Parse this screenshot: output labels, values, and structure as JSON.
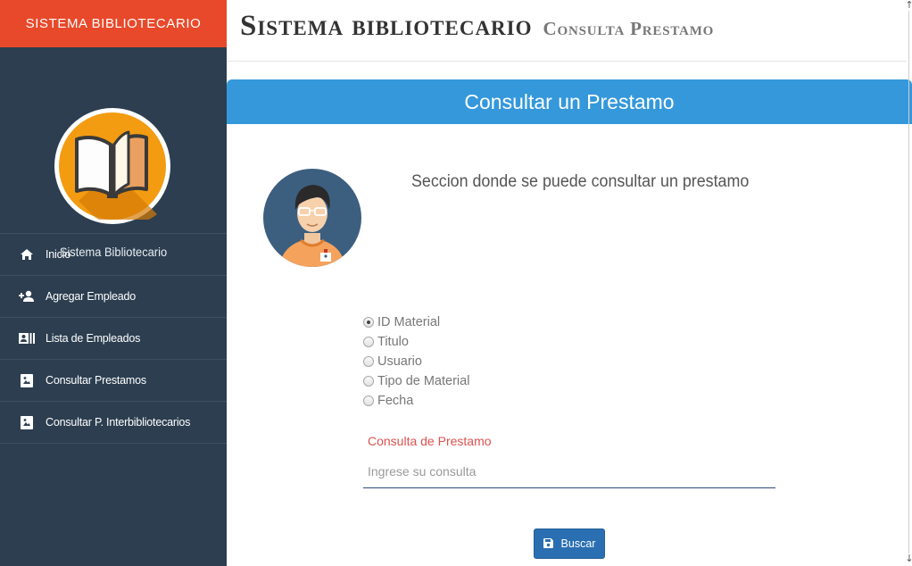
{
  "sidebar": {
    "brand": "SISTEMA BIBLIOTECARIO",
    "logo_icon": "open-book-icon",
    "profile_name": "Sistema Bibliotecario",
    "items": [
      {
        "label": "Inicio",
        "icon": "home-icon"
      },
      {
        "label": "Agregar Empleado",
        "icon": "add-user-icon"
      },
      {
        "label": "Lista de Empleados",
        "icon": "id-card-list-icon"
      },
      {
        "label": "Consultar Prestamos",
        "icon": "portrait-icon"
      },
      {
        "label": "Consultar P. Interbibliotecarios",
        "icon": "portrait-icon"
      }
    ]
  },
  "header": {
    "title": "Sistema bibliotecario",
    "subtitle": "Consulta Prestamo"
  },
  "banner": {
    "title": "Consultar un Prestamo"
  },
  "main": {
    "avatar_icon": "librarian-avatar-icon",
    "description": "Seccion donde se puede consultar un prestamo",
    "filters": [
      {
        "label": "ID Material",
        "checked": true
      },
      {
        "label": "Titulo",
        "checked": false
      },
      {
        "label": "Usuario",
        "checked": false
      },
      {
        "label": "Tipo de Material",
        "checked": false
      },
      {
        "label": "Fecha",
        "checked": false
      }
    ],
    "query_label": "Consulta de Prestamo",
    "query_placeholder": "Ingrese su consulta",
    "query_value": "",
    "search_button": "Buscar",
    "search_icon": "save-disk-icon"
  },
  "colors": {
    "brand": "#e8492a",
    "sidebar": "#2c3e50",
    "banner": "#3498db",
    "button": "#2a6fb1",
    "label_accent": "#d9534f"
  }
}
